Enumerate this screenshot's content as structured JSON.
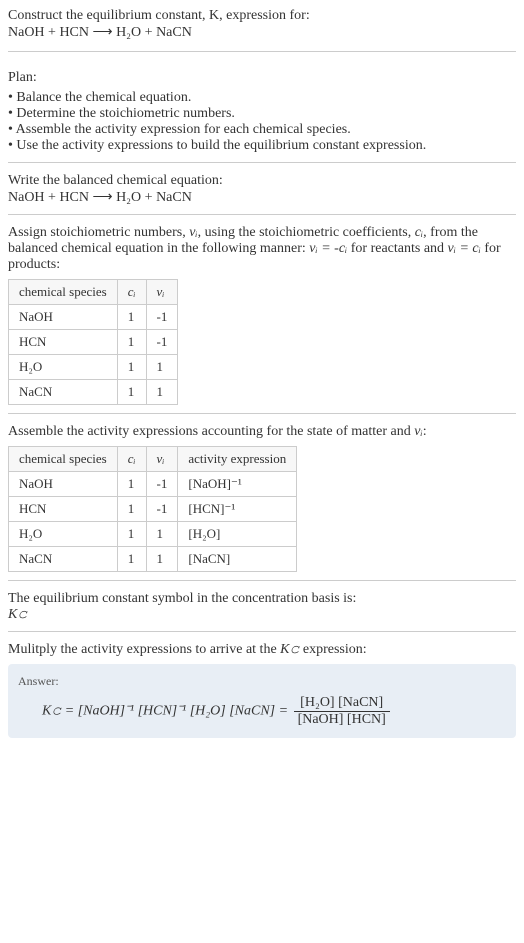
{
  "header": {
    "line1": "Construct the equilibrium constant, K, expression for:",
    "equation": "NaOH + HCN ⟶ H₂O + NaCN"
  },
  "plan": {
    "title": "Plan:",
    "items": [
      "Balance the chemical equation.",
      "Determine the stoichiometric numbers.",
      "Assemble the activity expression for each chemical species.",
      "Use the activity expressions to build the equilibrium constant expression."
    ]
  },
  "balanced": {
    "title": "Write the balanced chemical equation:",
    "equation": "NaOH + HCN ⟶ H₂O + NaCN"
  },
  "stoich": {
    "intro_a": "Assign stoichiometric numbers, ",
    "intro_b": ", using the stoichiometric coefficients, ",
    "intro_c": ", from the balanced chemical equation in the following manner: ",
    "intro_d": " for reactants and ",
    "intro_e": " for products:",
    "nu": "νᵢ",
    "ci": "cᵢ",
    "rel1": "νᵢ = -cᵢ",
    "rel2": "νᵢ = cᵢ",
    "headers": {
      "species": "chemical species",
      "ci": "cᵢ",
      "nu": "νᵢ"
    },
    "rows": [
      {
        "sp": "NaOH",
        "c": "1",
        "n": "-1"
      },
      {
        "sp": "HCN",
        "c": "1",
        "n": "-1"
      },
      {
        "sp": "H₂O",
        "c": "1",
        "n": "1"
      },
      {
        "sp": "NaCN",
        "c": "1",
        "n": "1"
      }
    ]
  },
  "activity": {
    "intro_a": "Assemble the activity expressions accounting for the state of matter and ",
    "intro_b": ":",
    "nu": "νᵢ",
    "headers": {
      "species": "chemical species",
      "ci": "cᵢ",
      "nu": "νᵢ",
      "expr": "activity expression"
    },
    "rows": [
      {
        "sp": "NaOH",
        "c": "1",
        "n": "-1",
        "e": "[NaOH]⁻¹"
      },
      {
        "sp": "HCN",
        "c": "1",
        "n": "-1",
        "e": "[HCN]⁻¹"
      },
      {
        "sp": "H₂O",
        "c": "1",
        "n": "1",
        "e": "[H₂O]"
      },
      {
        "sp": "NaCN",
        "c": "1",
        "n": "1",
        "e": "[NaCN]"
      }
    ]
  },
  "symbol": {
    "line": "The equilibrium constant symbol in the concentration basis is:",
    "sym": "K𝚌"
  },
  "multiply": {
    "line_a": "Mulitply the activity expressions to arrive at the ",
    "line_b": " expression:",
    "kc": "K𝚌"
  },
  "answer": {
    "label": "Answer:",
    "lhs": "K𝚌 = [NaOH]⁻¹ [HCN]⁻¹ [H₂O] [NaCN] = ",
    "num": "[H₂O] [NaCN]",
    "den": "[NaOH] [HCN]"
  }
}
